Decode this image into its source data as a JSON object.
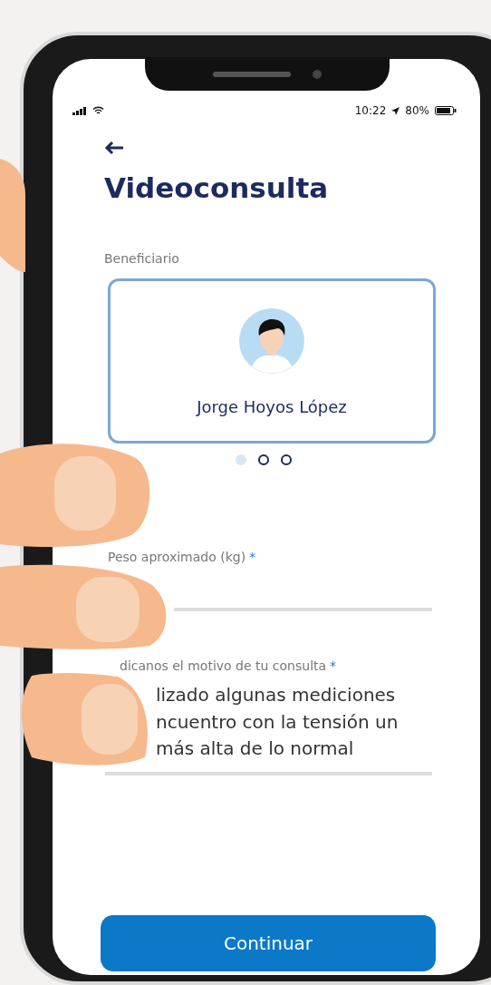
{
  "status_bar": {
    "time": "10:22",
    "battery": "80%"
  },
  "title": "Videoconsulta",
  "beneficiary": {
    "label": "Beneficiario",
    "name": "Jorge Hoyos López",
    "pages": [
      {
        "selected": true
      },
      {
        "selected": false
      },
      {
        "selected": false
      }
    ]
  },
  "weight_field": {
    "label": "Peso aproximado (kg)",
    "required_mark": "*"
  },
  "reason_field": {
    "label": "dicanos el motivo de tu consulta",
    "required_mark": "*",
    "value_lines": [
      "lizado algunas mediciones",
      "ncuentro con la tensión un",
      "más alta de lo normal"
    ]
  },
  "primary_button": "Continuar"
}
